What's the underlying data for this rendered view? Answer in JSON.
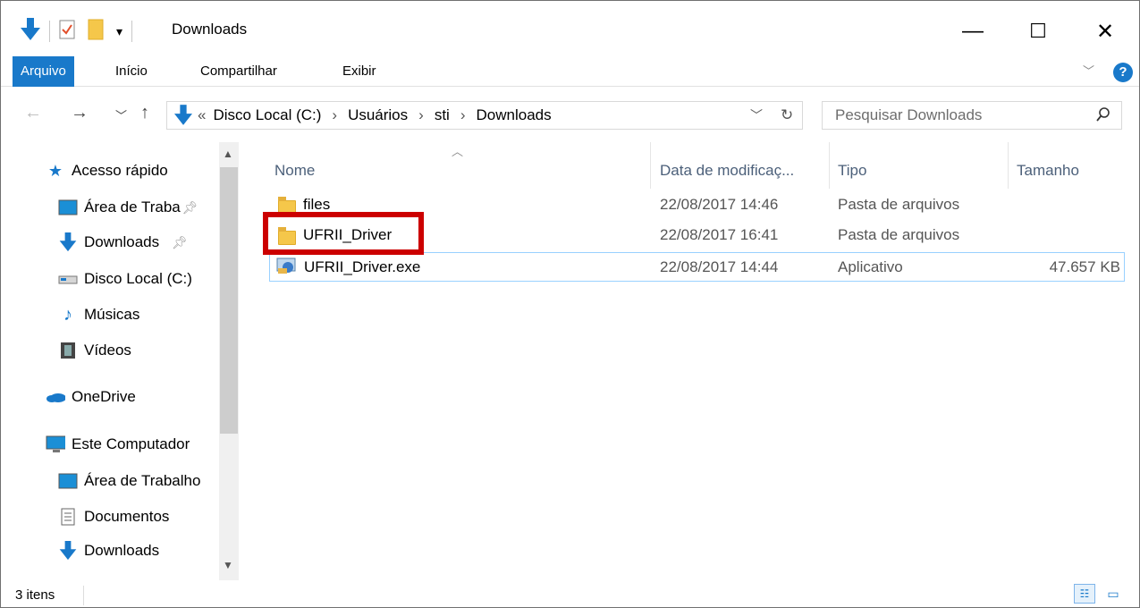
{
  "window": {
    "title": "Downloads",
    "minimize": "—",
    "maximize": "☐",
    "close": "✕"
  },
  "ribbon": {
    "tabs": [
      "Arquivo",
      "Início",
      "Compartilhar",
      "Exibir"
    ]
  },
  "address": {
    "overflow": "«",
    "crumbs": [
      "Disco Local (C:)",
      "Usuários",
      "sti",
      "Downloads"
    ],
    "separator": "›"
  },
  "search": {
    "placeholder": "Pesquisar Downloads"
  },
  "navpane": {
    "items": [
      {
        "label": "Acesso rápido",
        "icon": "star-icon"
      },
      {
        "label": "Área de Traba",
        "icon": "desktop-icon",
        "pinned": true
      },
      {
        "label": "Downloads",
        "icon": "download-arrow-icon",
        "pinned": true
      },
      {
        "label": "Disco Local (C:)",
        "icon": "drive-icon"
      },
      {
        "label": "Músicas",
        "icon": "music-icon"
      },
      {
        "label": "Vídeos",
        "icon": "film-icon"
      },
      {
        "label": "OneDrive",
        "icon": "cloud-icon"
      },
      {
        "label": "Este Computador",
        "icon": "computer-icon"
      },
      {
        "label": "Área de Trabalho",
        "icon": "desktop-icon"
      },
      {
        "label": "Documentos",
        "icon": "document-icon"
      },
      {
        "label": "Downloads",
        "icon": "download-arrow-icon"
      }
    ]
  },
  "columns": [
    "Nome",
    "Data de modificaç...",
    "Tipo",
    "Tamanho"
  ],
  "files": [
    {
      "name": "files",
      "date": "22/08/2017 14:46",
      "type": "Pasta de arquivos",
      "size": "",
      "icon": "folder-icon"
    },
    {
      "name": "UFRII_Driver",
      "date": "22/08/2017 16:41",
      "type": "Pasta de arquivos",
      "size": "",
      "icon": "folder-icon"
    },
    {
      "name": "UFRII_Driver.exe",
      "date": "22/08/2017 14:44",
      "type": "Aplicativo",
      "size": "47.657 KB",
      "icon": "exe-icon"
    }
  ],
  "status": {
    "count": "3 itens"
  },
  "colors": {
    "accent": "#1979ca",
    "highlight": "#cc0000",
    "selection_border": "#99d1ff"
  }
}
